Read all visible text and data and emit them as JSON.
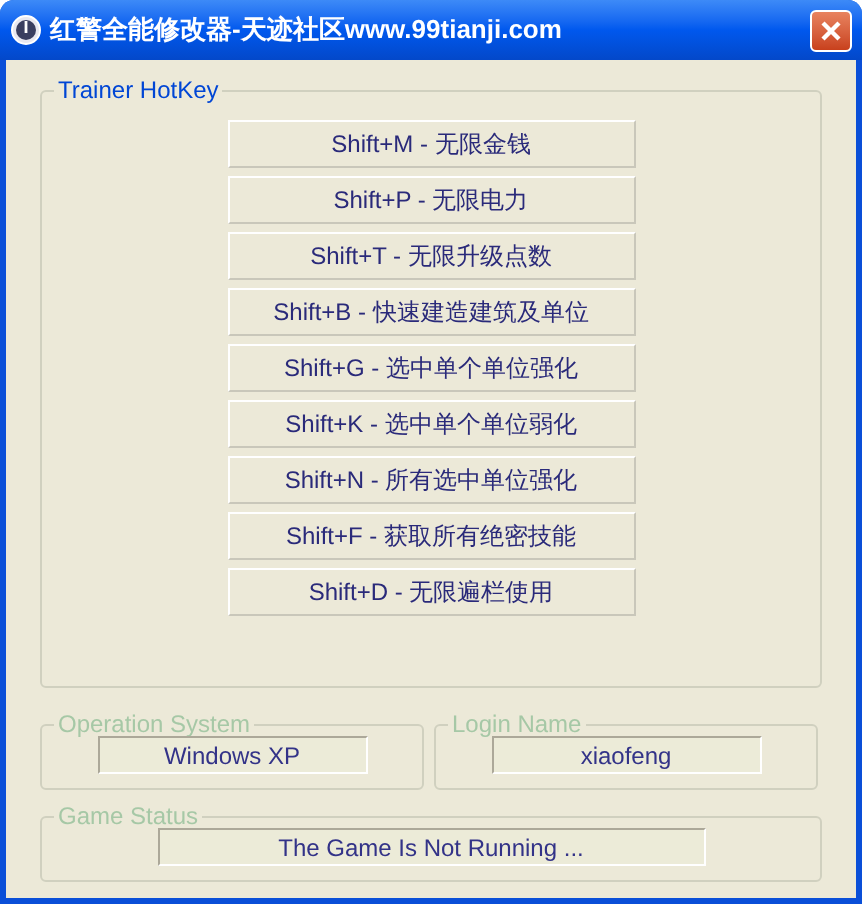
{
  "window": {
    "title": "红警全能修改器-天迹社区www.99tianji.com"
  },
  "hotkeys": {
    "title": "Trainer HotKey",
    "buttons": [
      "Shift+M - 无限金钱",
      "Shift+P - 无限电力",
      "Shift+T - 无限升级点数",
      "Shift+B - 快速建造建筑及单位",
      "Shift+G - 选中单个单位强化",
      "Shift+K - 选中单个单位弱化",
      "Shift+N - 所有选中单位强化",
      "Shift+F - 获取所有绝密技能",
      "Shift+D - 无限遍栏使用"
    ]
  },
  "operation_system": {
    "title": "Operation System",
    "value": "Windows XP",
    "disabled": true
  },
  "login_name": {
    "title": "Login Name",
    "value": "xiaofeng",
    "disabled": true
  },
  "game_status": {
    "title": "Game Status",
    "value": "The Game Is Not Running ...",
    "disabled": true
  }
}
